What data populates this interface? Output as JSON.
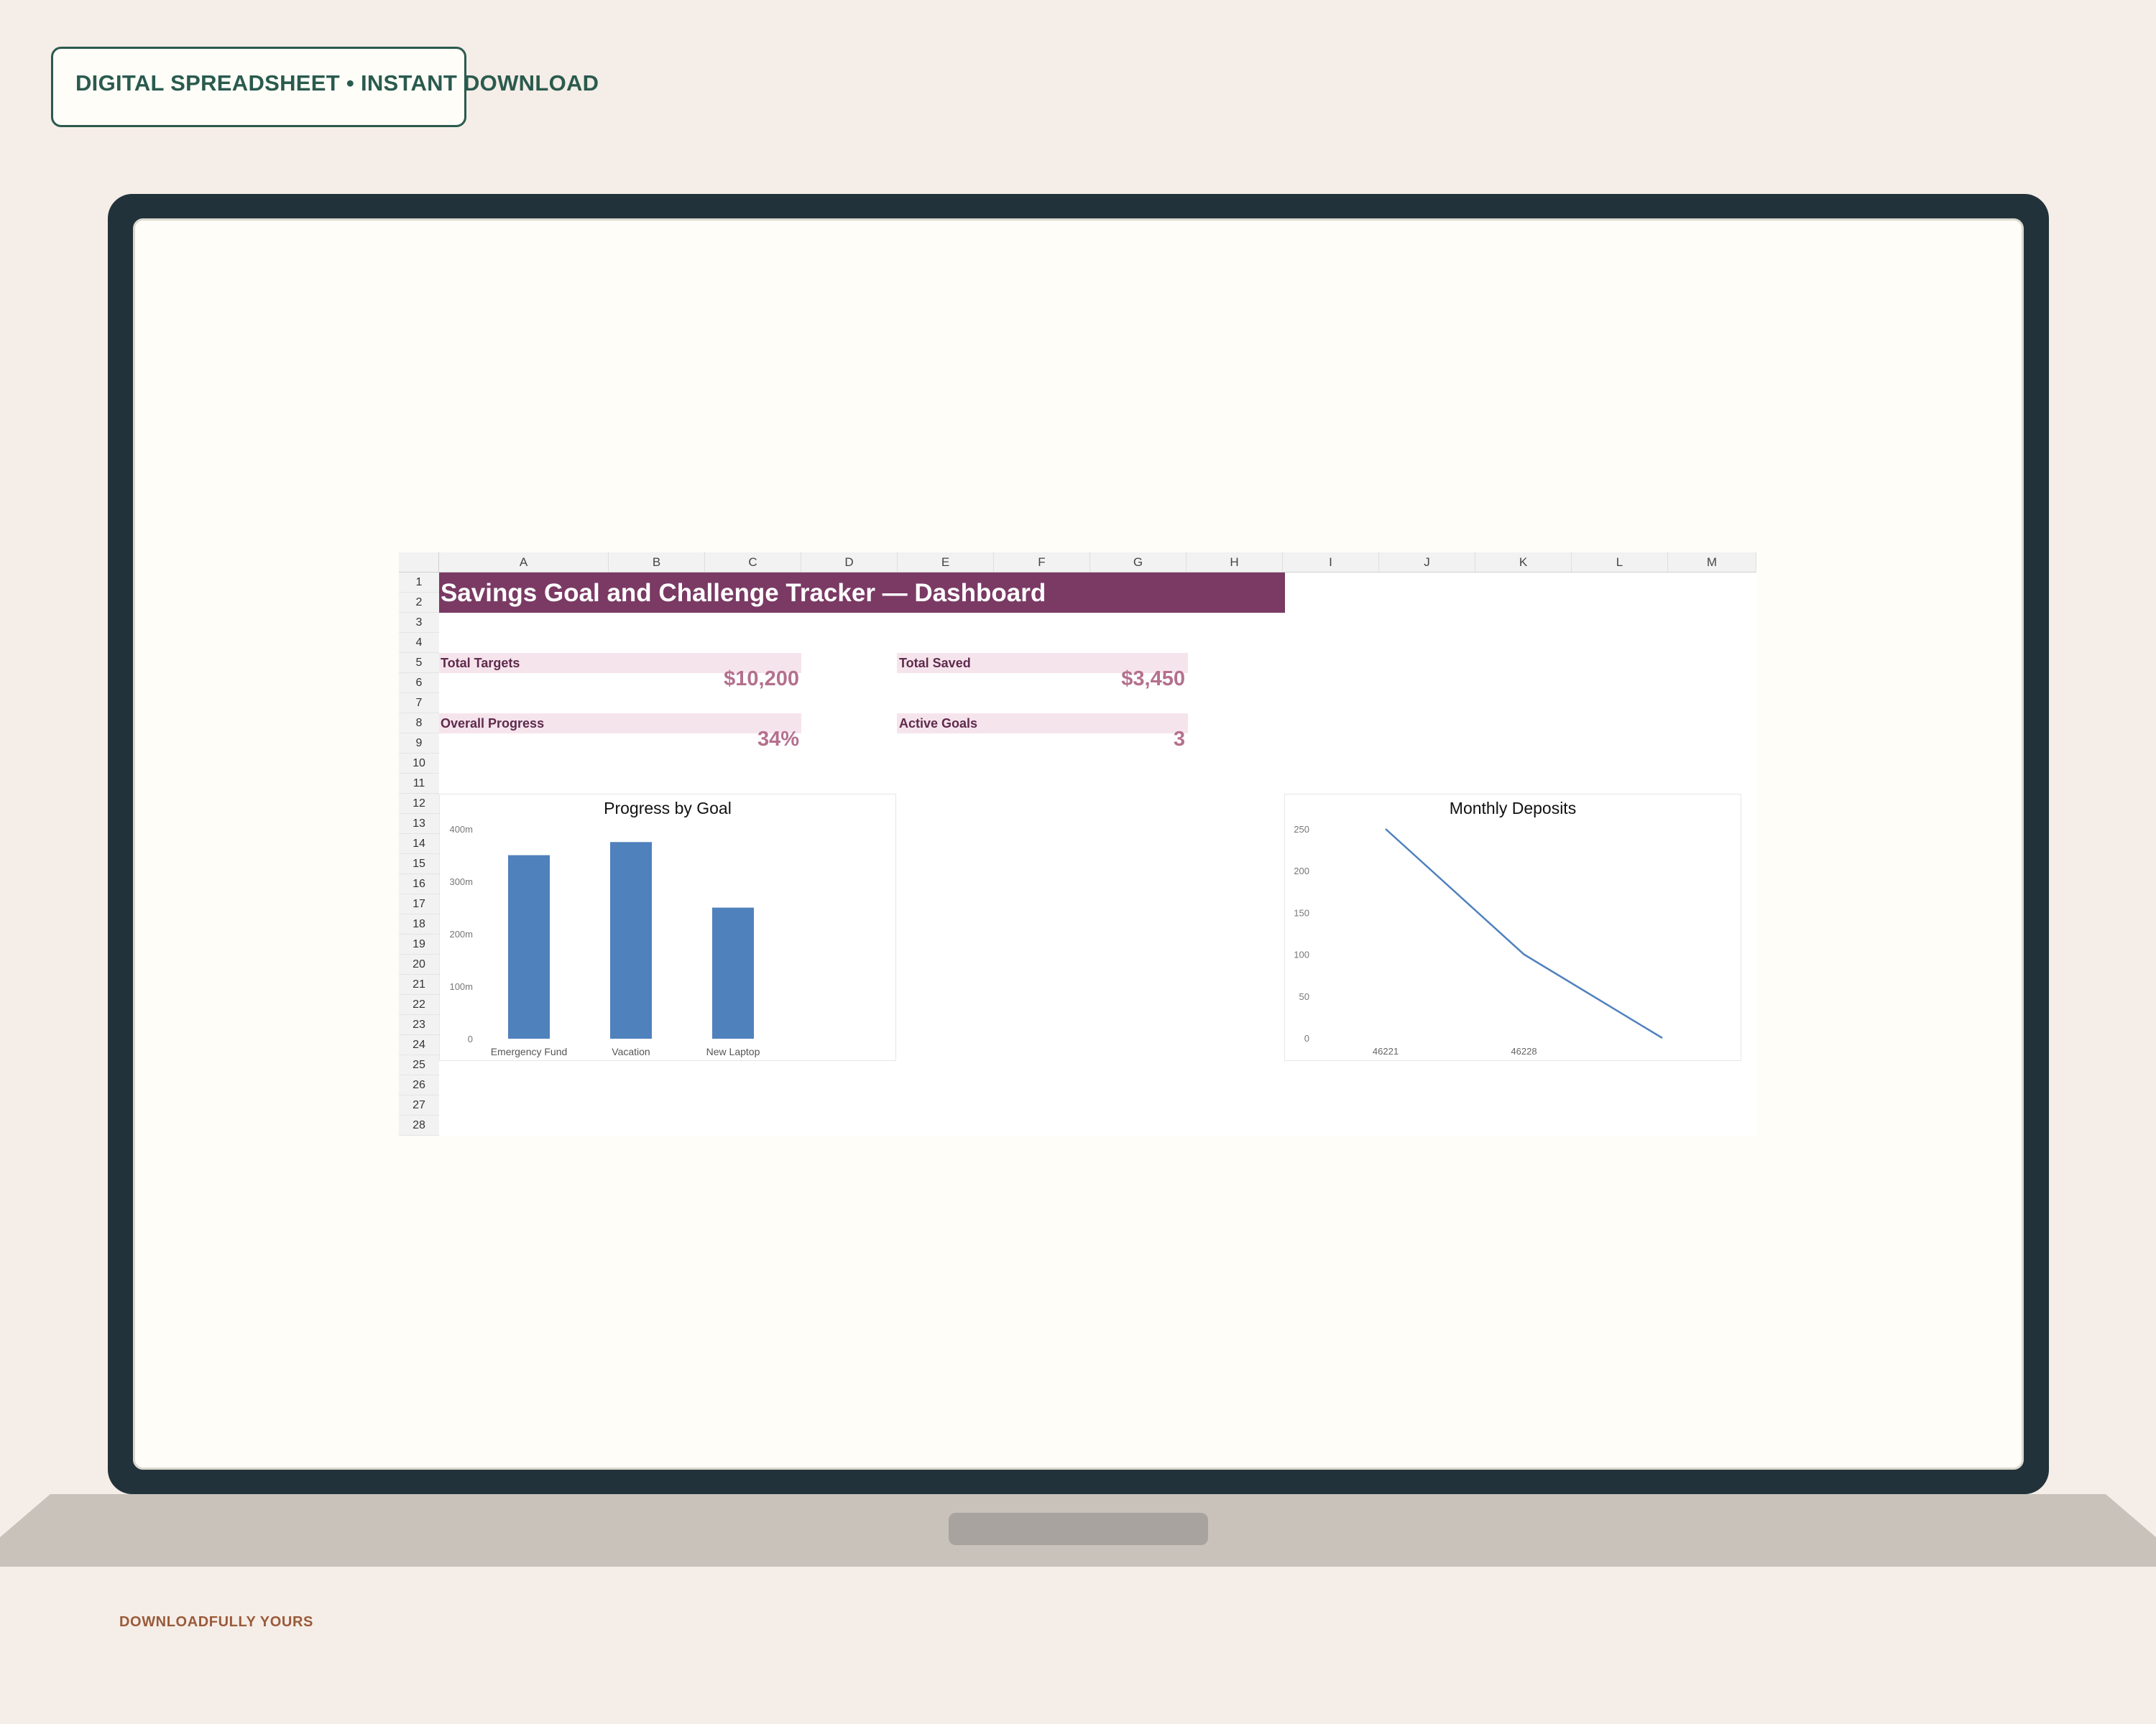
{
  "banner": {
    "text": "DIGITAL SPREADSHEET • INSTANT DOWNLOAD"
  },
  "brand": {
    "text": "DOWNLOADFULLY YOURS"
  },
  "sheet": {
    "columns": [
      "A",
      "B",
      "C",
      "D",
      "E",
      "F",
      "G",
      "H",
      "I",
      "J",
      "K",
      "L",
      "M"
    ],
    "rows": [
      "1",
      "2",
      "3",
      "4",
      "5",
      "6",
      "7",
      "8",
      "9",
      "10",
      "11",
      "12",
      "13",
      "14",
      "15",
      "16",
      "17",
      "18",
      "19",
      "20",
      "21",
      "22",
      "23",
      "24",
      "25",
      "26",
      "27",
      "28"
    ],
    "title": "Savings Goal and Challenge Tracker — Dashboard",
    "kpis": {
      "total_targets_label": "Total Targets",
      "total_targets_value": "$10,200",
      "total_saved_label": "Total Saved",
      "total_saved_value": "$3,450",
      "overall_progress_label": "Overall Progress",
      "overall_progress_value": "34%",
      "active_goals_label": "Active Goals",
      "active_goals_value": "3"
    }
  },
  "colors": {
    "title_bg": "#7a3a64",
    "kpi_band": "#f6e4ec",
    "kpi_value": "#b4708d",
    "series": "#4f81bd",
    "bezel": "#22323a"
  },
  "chart_data": [
    {
      "type": "bar",
      "title": "Progress by Goal",
      "categories": [
        "Emergency Fund",
        "Vacation",
        "New Laptop"
      ],
      "values": [
        0.35,
        0.375,
        0.25
      ],
      "yticks": [
        "0",
        "100m",
        "200m",
        "300m",
        "400m"
      ],
      "ylim": [
        0,
        0.4
      ],
      "xlabel": "",
      "ylabel": "",
      "legend": "none",
      "grid": false
    },
    {
      "type": "line",
      "title": "Monthly Deposits",
      "x": [
        46221,
        46228,
        46235
      ],
      "values": [
        250,
        100,
        0
      ],
      "xticks": [
        "46221",
        "46228"
      ],
      "yticks": [
        "0",
        "50",
        "100",
        "150",
        "200",
        "250"
      ],
      "ylim": [
        0,
        250
      ],
      "xlabel": "",
      "ylabel": "",
      "legend": "none",
      "grid": false
    }
  ]
}
